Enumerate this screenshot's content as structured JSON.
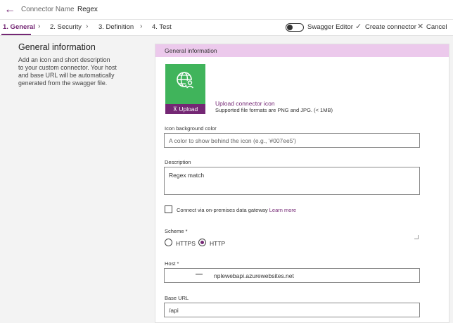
{
  "header": {
    "connector_name_label": "Connector Name",
    "connector_name_value": "Regex"
  },
  "tabs": [
    {
      "label": "1. General",
      "active": true
    },
    {
      "label": "2. Security",
      "active": false
    },
    {
      "label": "3. Definition",
      "active": false
    },
    {
      "label": "4. Test",
      "active": false
    }
  ],
  "toolbar": {
    "swagger_editor_label": "Swagger Editor",
    "swagger_editor_on": false,
    "create_label": "Create connector",
    "cancel_label": "Cancel"
  },
  "left": {
    "title": "General information",
    "description": "Add an icon and short description to your custom connector. Your host and base URL will be automatically generated from the swagger file."
  },
  "panel": {
    "header": "General information",
    "upload_button": "Upload",
    "upload_link": "Upload connector icon",
    "upload_hint": "Supported file formats are PNG and JPG. (< 1MB)",
    "icon_color_label": "Icon background color",
    "icon_color_placeholder": "A color to show behind the icon (e.g., '#007ee5')",
    "icon_color_value": "",
    "description_label": "Description",
    "description_value": "Regex match",
    "gateway_label": "Connect via on-premises data gateway",
    "gateway_link": "Learn more",
    "gateway_checked": false,
    "scheme_label": "Scheme *",
    "scheme_options": [
      "HTTPS",
      "HTTP"
    ],
    "scheme_selected": "HTTP",
    "host_label": "Host *",
    "host_value": "nplewebapi.azurewebsites.net",
    "base_url_label": "Base URL",
    "base_url_value": "/api"
  },
  "colors": {
    "accent": "#742774",
    "panel_header_bg": "#ecc9ec",
    "icon_bg": "#40b45b"
  },
  "icons": {
    "back": "arrow-left-icon",
    "globe": "globe-person-icon",
    "check": "check-icon",
    "close": "close-icon",
    "upload": "upload-arrow-icon"
  }
}
